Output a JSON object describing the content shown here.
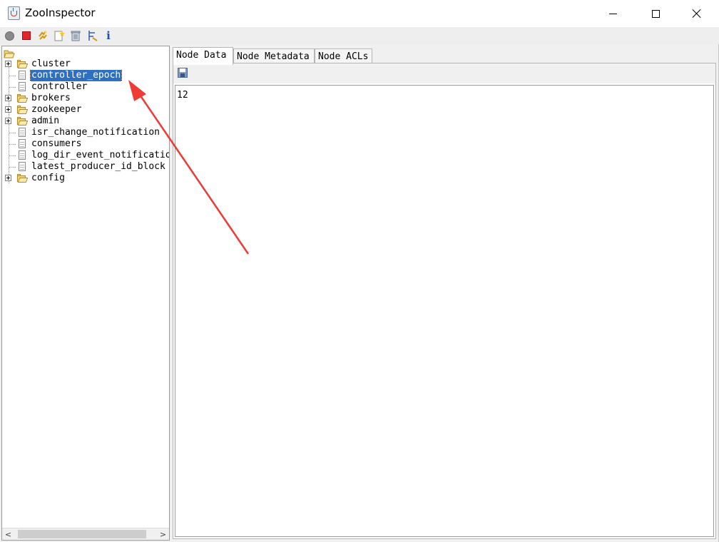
{
  "window": {
    "title": "ZooInspector"
  },
  "toolbar": {
    "buttons": [
      {
        "name": "connect",
        "icon": "connect-icon"
      },
      {
        "name": "disconnect",
        "icon": "stop-icon"
      },
      {
        "name": "refresh",
        "icon": "refresh-icon"
      },
      {
        "name": "add-node",
        "icon": "add-node-icon"
      },
      {
        "name": "delete-node",
        "icon": "trash-icon"
      },
      {
        "name": "settings",
        "icon": "settings-icon"
      },
      {
        "name": "about",
        "icon": "info-icon",
        "glyph": "i"
      }
    ]
  },
  "tree": {
    "items": [
      {
        "label": "cluster",
        "type": "folder",
        "expandable": true
      },
      {
        "label": "controller_epoch",
        "type": "file",
        "expandable": false,
        "selected": true
      },
      {
        "label": "controller",
        "type": "file",
        "expandable": false
      },
      {
        "label": "brokers",
        "type": "folder",
        "expandable": true
      },
      {
        "label": "zookeeper",
        "type": "folder",
        "expandable": true
      },
      {
        "label": "admin",
        "type": "folder",
        "expandable": true
      },
      {
        "label": "isr_change_notification",
        "type": "file",
        "expandable": false
      },
      {
        "label": "consumers",
        "type": "file",
        "expandable": false
      },
      {
        "label": "log_dir_event_notification",
        "type": "file",
        "expandable": false
      },
      {
        "label": "latest_producer_id_block",
        "type": "file",
        "expandable": false
      },
      {
        "label": "config",
        "type": "folder",
        "expandable": true
      }
    ],
    "scroll_left": "<",
    "scroll_right": ">"
  },
  "tabs": [
    {
      "label": "Node Data",
      "active": true
    },
    {
      "label": "Node Metadata",
      "active": false
    },
    {
      "label": "Node ACLs",
      "active": false
    }
  ],
  "node_data": {
    "value": "12"
  },
  "colors": {
    "selection": "#2f6fbf",
    "annotation_arrow": "#ee3b36"
  }
}
